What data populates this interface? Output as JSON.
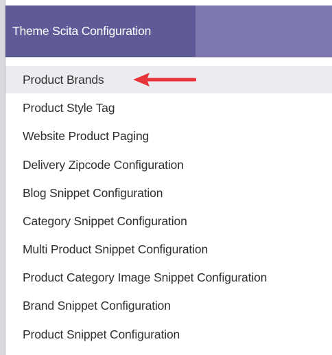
{
  "header": {
    "tab_label": "Theme Scita Configuration"
  },
  "menu": {
    "items": [
      {
        "label": "Product Brands",
        "active": true
      },
      {
        "label": "Product Style Tag",
        "active": false
      },
      {
        "label": "Website Product Paging",
        "active": false
      },
      {
        "label": "Delivery Zipcode Configuration",
        "active": false
      },
      {
        "label": "Blog Snippet Configuration",
        "active": false
      },
      {
        "label": "Category Snippet Configuration",
        "active": false
      },
      {
        "label": "Multi Product Snippet Configuration",
        "active": false
      },
      {
        "label": "Product Category Image Snippet Configuration",
        "active": false
      },
      {
        "label": "Brand Snippet Configuration",
        "active": false
      },
      {
        "label": "Product Snippet Configuration",
        "active": false
      }
    ]
  },
  "annotation": {
    "arrow_icon": "left-arrow-icon",
    "arrow_color": "#e8353a"
  },
  "colors": {
    "header_bar": "#7c78ad",
    "header_tab": "#5f5b98",
    "active_item_bg": "#eaecef",
    "item_text": "#2f2f2f"
  }
}
